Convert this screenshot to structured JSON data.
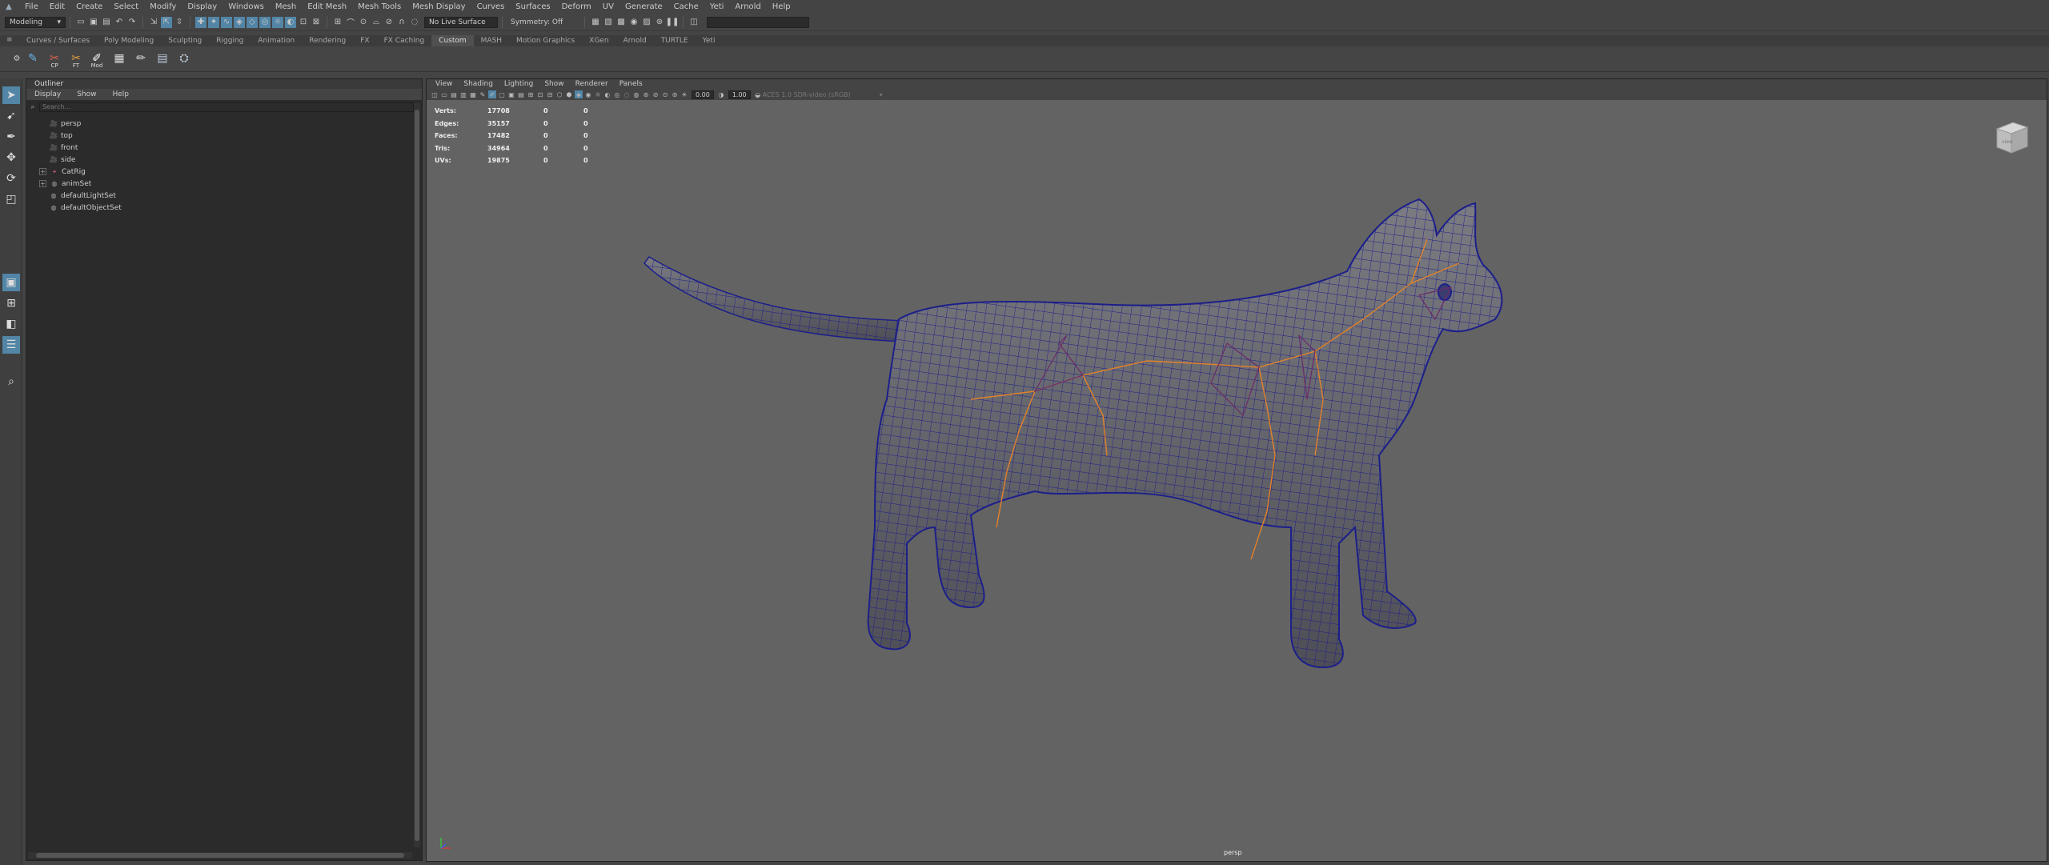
{
  "menubar": {
    "items": [
      "File",
      "Edit",
      "Create",
      "Select",
      "Modify",
      "Display",
      "Windows",
      "Mesh",
      "Edit Mesh",
      "Mesh Tools",
      "Mesh Display",
      "Curves",
      "Surfaces",
      "Deform",
      "UV",
      "Generate",
      "Cache",
      "Yeti",
      "Arnold",
      "Help"
    ]
  },
  "statusline": {
    "menuset": "Modeling",
    "live_surface": "No Live Surface",
    "symmetry": "Symmetry: Off"
  },
  "shelf": {
    "tabs": [
      "Curves / Surfaces",
      "Poly Modeling",
      "Sculpting",
      "Rigging",
      "Animation",
      "Rendering",
      "FX",
      "FX Caching",
      "Custom",
      "MASH",
      "Motion Graphics",
      "XGen",
      "Arnold",
      "TURTLE",
      "Yeti"
    ],
    "active_tab": "Custom",
    "button_labels": [
      "CP",
      "FT",
      "Mod"
    ]
  },
  "outliner": {
    "title": "Outliner",
    "menu": [
      "Display",
      "Show",
      "Help"
    ],
    "search_placeholder": "Search...",
    "items": [
      {
        "label": "persp",
        "icon": "camera-icon",
        "expandable": false
      },
      {
        "label": "top",
        "icon": "camera-icon",
        "expandable": false
      },
      {
        "label": "front",
        "icon": "camera-icon",
        "expandable": false
      },
      {
        "label": "side",
        "icon": "camera-icon",
        "expandable": false
      },
      {
        "label": "CatRig",
        "icon": "transform-icon",
        "expandable": true
      },
      {
        "label": "animSet",
        "icon": "set-icon",
        "expandable": true
      },
      {
        "label": "defaultLightSet",
        "icon": "set-icon",
        "expandable": false
      },
      {
        "label": "defaultObjectSet",
        "icon": "set-icon",
        "expandable": false
      }
    ]
  },
  "viewport": {
    "menu": [
      "View",
      "Shading",
      "Lighting",
      "Show",
      "Renderer",
      "Panels"
    ],
    "near_value": "0.00",
    "far_value": "1.00",
    "color_space": "ACES 1.0 SDR-video (sRGB)",
    "camera": "persp",
    "viewcube_label": "view",
    "hud": [
      {
        "label": "Verts:",
        "v1": "17708",
        "v2": "0",
        "v3": "0"
      },
      {
        "label": "Edges:",
        "v1": "35157",
        "v2": "0",
        "v3": "0"
      },
      {
        "label": "Faces:",
        "v1": "17482",
        "v2": "0",
        "v3": "0"
      },
      {
        "label": "Tris:",
        "v1": "34964",
        "v2": "0",
        "v3": "0"
      },
      {
        "label": "UVs:",
        "v1": "19875",
        "v2": "0",
        "v3": "0"
      }
    ]
  },
  "colors": {
    "accent": "#5285a6",
    "wireframe": "#1c1f8a",
    "mesh": "#6b6b72",
    "joints": "#e2822a",
    "background_viewport": "#636363"
  }
}
